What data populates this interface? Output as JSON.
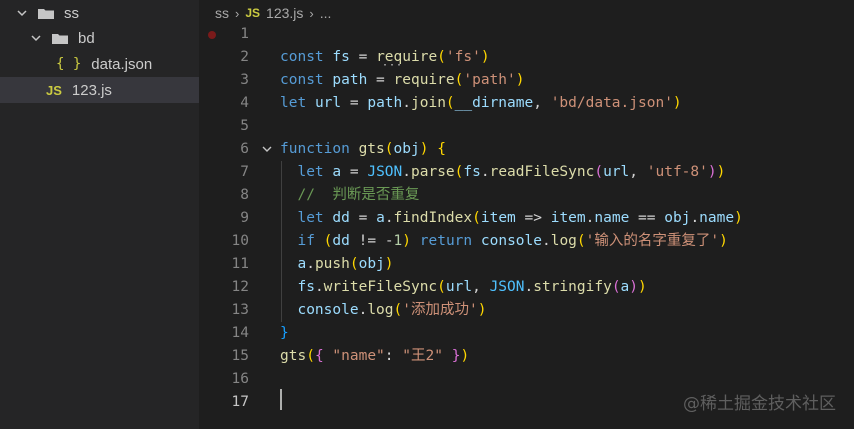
{
  "explorer": {
    "items": [
      {
        "label": "ss",
        "type": "folder",
        "depth": 0
      },
      {
        "label": "bd",
        "type": "folder",
        "depth": 1
      },
      {
        "label": "data.json",
        "type": "json",
        "badge": "{ }",
        "depth": 2
      },
      {
        "label": "123.js",
        "type": "js",
        "badge": "JS",
        "depth": 1,
        "selected": true
      }
    ]
  },
  "breadcrumb": {
    "folder": "ss",
    "js_badge": "JS",
    "file": "123.js",
    "more": "..."
  },
  "editor": {
    "lines": [
      {
        "n": "1",
        "text": ""
      },
      {
        "n": "2",
        "text": "const fs = require('fs')"
      },
      {
        "n": "3",
        "text": "const path = require('path')"
      },
      {
        "n": "4",
        "text": "let url = path.join(__dirname, 'bd/data.json')"
      },
      {
        "n": "5",
        "text": ""
      },
      {
        "n": "6",
        "text": "function gts(obj) {"
      },
      {
        "n": "7",
        "text": "  let a = JSON.parse(fs.readFileSync(url, 'utf-8'))"
      },
      {
        "n": "8",
        "text": "  //  判断是否重复"
      },
      {
        "n": "9",
        "text": "  let dd = a.findIndex(item => item.name == obj.name)"
      },
      {
        "n": "10",
        "text": "  if (dd != -1) return console.log('输入的名字重复了')"
      },
      {
        "n": "11",
        "text": "  a.push(obj)"
      },
      {
        "n": "12",
        "text": "  fs.writeFileSync(url, JSON.stringify(a))"
      },
      {
        "n": "13",
        "text": "  console.log('添加成功')"
      },
      {
        "n": "14",
        "text": "}"
      },
      {
        "n": "15",
        "text": "gts({ \"name\": \"王2\" })"
      },
      {
        "n": "16",
        "text": ""
      },
      {
        "n": "17",
        "text": ""
      }
    ]
  },
  "watermark": "@稀土掘金技术社区",
  "colors": {
    "background": "#1e1e1e",
    "sidebar": "#252526",
    "selected": "#37373d",
    "keyword": "#569cd6",
    "string": "#ce9178",
    "function": "#dcdcaa",
    "comment": "#6a9955"
  }
}
